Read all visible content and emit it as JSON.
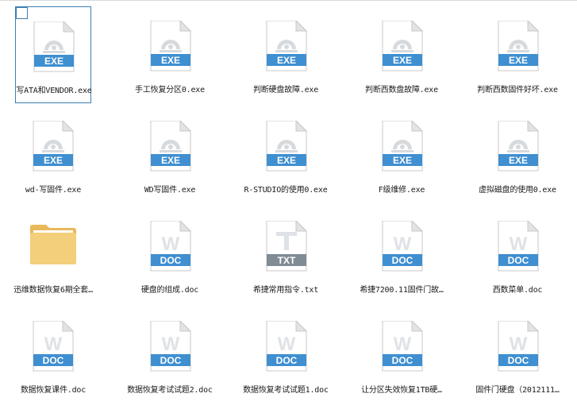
{
  "colors": {
    "exe_band": "#3f8fd1",
    "doc_band": "#3f8fd1",
    "txt_band": "#808b96",
    "doc_glyph": "#dfe2e6",
    "exe_glyph": "#d7dadd",
    "folder": "#f3cf7b",
    "selection": "#3c7fb1"
  },
  "files": [
    {
      "name": "写ATA和VENDOR.exe",
      "type": "exe",
      "badge": "EXE",
      "icon": "exe-icon",
      "selected": true
    },
    {
      "name": "手工恢复分区0.exe",
      "type": "exe",
      "badge": "EXE",
      "icon": "exe-icon"
    },
    {
      "name": "判断硬盘故障.exe",
      "type": "exe",
      "badge": "EXE",
      "icon": "exe-icon"
    },
    {
      "name": "判断西数盘故障.exe",
      "type": "exe",
      "badge": "EXE",
      "icon": "exe-icon"
    },
    {
      "name": "判断西数固件好坏.exe",
      "type": "exe",
      "badge": "EXE",
      "icon": "exe-icon"
    },
    {
      "name": "wd-写固件.exe",
      "type": "exe",
      "badge": "EXE",
      "icon": "exe-icon"
    },
    {
      "name": "WD写固件.exe",
      "type": "exe",
      "badge": "EXE",
      "icon": "exe-icon"
    },
    {
      "name": "R-STUDIO的使用0.exe",
      "type": "exe",
      "badge": "EXE",
      "icon": "exe-icon"
    },
    {
      "name": "F级维修.exe",
      "type": "exe",
      "badge": "EXE",
      "icon": "exe-icon"
    },
    {
      "name": "虚拟磁盘的使用0.exe",
      "type": "exe",
      "badge": "EXE",
      "icon": "exe-icon"
    },
    {
      "name": "迅维数据恢复6期全套…",
      "type": "folder",
      "badge": "",
      "icon": "folder-icon"
    },
    {
      "name": "硬盘的组成.doc",
      "type": "doc",
      "badge": "DOC",
      "icon": "doc-icon"
    },
    {
      "name": "希捷常用指令.txt",
      "type": "txt",
      "badge": "TXT",
      "icon": "txt-icon"
    },
    {
      "name": "希捷7200.11固件门故…",
      "type": "doc",
      "badge": "DOC",
      "icon": "doc-icon"
    },
    {
      "name": "西数菜单.doc",
      "type": "doc",
      "badge": "DOC",
      "icon": "doc-icon"
    },
    {
      "name": "数据恢复课件.doc",
      "type": "doc",
      "badge": "DOC",
      "icon": "doc-icon"
    },
    {
      "name": "数据恢复考试试题2.doc",
      "type": "doc",
      "badge": "DOC",
      "icon": "doc-icon"
    },
    {
      "name": "数据恢复考试试题1.doc",
      "type": "doc",
      "badge": "DOC",
      "icon": "doc-icon"
    },
    {
      "name": "让分区失效恢复1TB硬…",
      "type": "doc",
      "badge": "DOC",
      "icon": "doc-icon"
    },
    {
      "name": "固件门硬盘（2012111…",
      "type": "doc",
      "badge": "DOC",
      "icon": "doc-icon"
    }
  ]
}
